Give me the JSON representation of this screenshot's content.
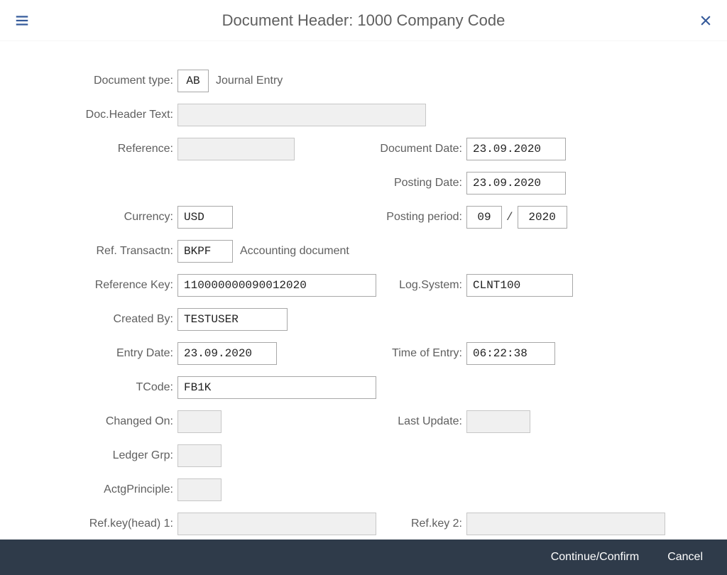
{
  "header": {
    "title": "Document Header: 1000 Company Code"
  },
  "labels": {
    "doc_type": "Document type:",
    "doc_header_text": "Doc.Header Text:",
    "reference": "Reference:",
    "document_date": "Document Date:",
    "posting_date": "Posting Date:",
    "currency": "Currency:",
    "posting_period": "Posting period:",
    "ref_transactn": "Ref. Transactn:",
    "reference_key": "Reference Key:",
    "log_system": "Log.System:",
    "created_by": "Created By:",
    "entry_date": "Entry Date:",
    "time_of_entry": "Time of Entry:",
    "tcode": "TCode:",
    "changed_on": "Changed On:",
    "last_update": "Last Update:",
    "ledger_grp": "Ledger Grp:",
    "actg_principle": "ActgPrinciple:",
    "ref_key_head_1": "Ref.key(head) 1:",
    "ref_key_2": "Ref.key 2:"
  },
  "values": {
    "doc_type_code": "AB",
    "doc_type_desc": "Journal Entry",
    "doc_header_text": "",
    "reference": "",
    "document_date": "23.09.2020",
    "posting_date": "23.09.2020",
    "currency": "USD",
    "posting_period_month": "09",
    "posting_period_year": "2020",
    "ref_transactn_code": "BKPF",
    "ref_transactn_desc": "Accounting document",
    "reference_key": "110000000090012020",
    "log_system": "CLNT100",
    "created_by": "TESTUSER",
    "entry_date": "23.09.2020",
    "time_of_entry": "06:22:38",
    "tcode": "FB1K",
    "changed_on": "",
    "last_update": "",
    "ledger_grp": "",
    "actg_principle": "",
    "ref_key_head_1": "",
    "ref_key_2": ""
  },
  "footer": {
    "continue": "Continue/Confirm",
    "cancel": "Cancel"
  }
}
